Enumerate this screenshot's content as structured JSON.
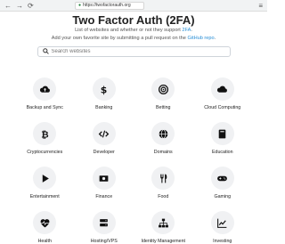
{
  "browser": {
    "back": "←",
    "forward": "→",
    "reload": "⟳",
    "url": "https://twofactorauth.org",
    "menu": "≡"
  },
  "hero": {
    "title": "Two Factor Auth (2FA)",
    "line1_prefix": "List of websites and whether or not they support",
    "line1_link": "2FA",
    "line1_suffix": ".",
    "line2_prefix": "Add your own favorite site by submitting a pull request on the",
    "line2_link": "GitHub repo",
    "line2_suffix": "."
  },
  "search": {
    "placeholder": "Search websites"
  },
  "categories": [
    {
      "label": "Backup and Sync",
      "icon": "cloud-upload-icon"
    },
    {
      "label": "Banking",
      "icon": "dollar-icon"
    },
    {
      "label": "Betting",
      "icon": "target-icon"
    },
    {
      "label": "Cloud Computing",
      "icon": "cloud-icon"
    },
    {
      "label": "Cryptocurrencies",
      "icon": "bitcoin-icon"
    },
    {
      "label": "Developer",
      "icon": "code-icon"
    },
    {
      "label": "Domains",
      "icon": "globe-icon"
    },
    {
      "label": "Education",
      "icon": "book-icon"
    },
    {
      "label": "Entertainment",
      "icon": "play-icon"
    },
    {
      "label": "Finance",
      "icon": "money-icon"
    },
    {
      "label": "Food",
      "icon": "utensils-icon"
    },
    {
      "label": "Gaming",
      "icon": "gamepad-icon"
    },
    {
      "label": "Health",
      "icon": "heartbeat-icon"
    },
    {
      "label": "Hosting/VPS",
      "icon": "server-icon"
    },
    {
      "label": "Identity Management",
      "icon": "sitemap-icon"
    },
    {
      "label": "Investing",
      "icon": "chart-line-icon"
    }
  ]
}
